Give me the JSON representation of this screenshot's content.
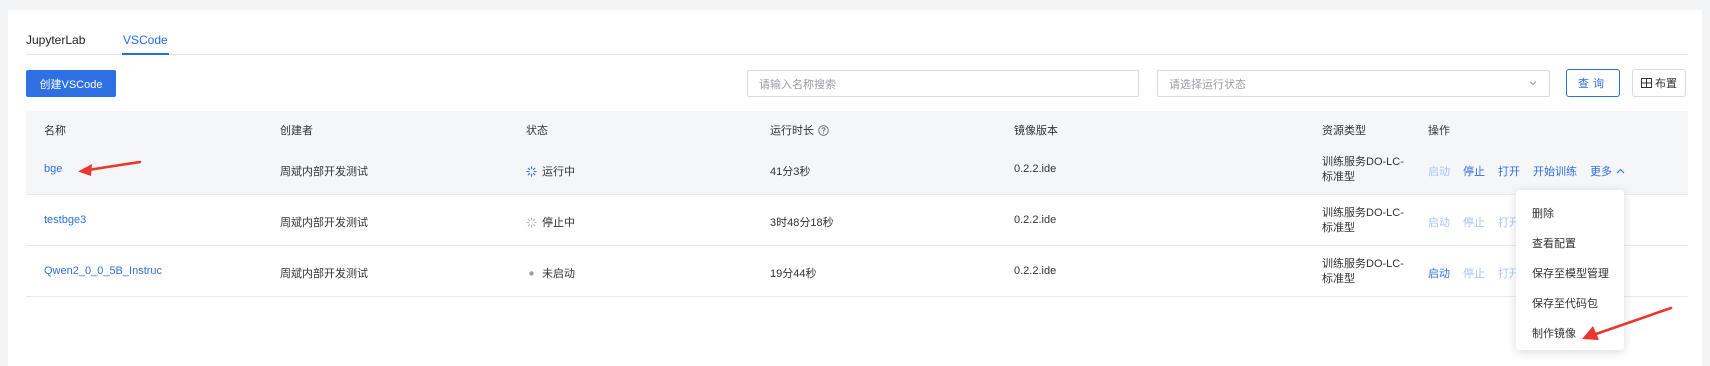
{
  "tabs": [
    {
      "label": "JupyterLab",
      "active": false
    },
    {
      "label": "VSCode",
      "active": true
    }
  ],
  "toolbar": {
    "create_label": "创建VSCode",
    "search_placeholder": "请输入名称搜索",
    "status_placeholder": "请选择运行状态",
    "query_label": "查询",
    "columns_label": "布置"
  },
  "table": {
    "headers": {
      "name": "名称",
      "creator": "创建者",
      "status": "状态",
      "runtime": "运行时长",
      "image": "镜像版本",
      "resource": "资源类型",
      "actions": "操作"
    },
    "rows": [
      {
        "name": "bge",
        "creator": "周斌内部开发测试",
        "status": "运行中",
        "status_kind": "running",
        "runtime": "41分3秒",
        "image": "0.2.2.ide",
        "resource_line1": "训练服务DO-LC-",
        "resource_line2": "标准型",
        "actions": {
          "start": "启动",
          "stop": "停止",
          "open": "打开",
          "train": "开始训练",
          "more": "更多"
        }
      },
      {
        "name": "testbge3",
        "creator": "周斌内部开发测试",
        "status": "停止中",
        "status_kind": "stopping",
        "runtime": "3时48分18秒",
        "image": "0.2.2.ide",
        "resource_line1": "训练服务DO-LC-",
        "resource_line2": "标准型",
        "actions": {
          "start": "启动",
          "stop": "停止",
          "open": "打开"
        }
      },
      {
        "name": "Qwen2_0_0_5B_Instruc",
        "creator": "周斌内部开发测试",
        "status": "未启动",
        "status_kind": "idle",
        "runtime": "19分44秒",
        "image": "0.2.2.ide",
        "resource_line1": "训练服务DO-LC-",
        "resource_line2": "标准型",
        "actions": {
          "start": "启动",
          "stop": "停止",
          "open": "打开"
        }
      }
    ]
  },
  "more_menu": {
    "items": [
      "删除",
      "查看配置",
      "保存至模型管理",
      "保存至代码包",
      "制作镜像"
    ]
  },
  "colors": {
    "accent": "#2f6fe4",
    "annotation_arrow": "#e8382d"
  }
}
